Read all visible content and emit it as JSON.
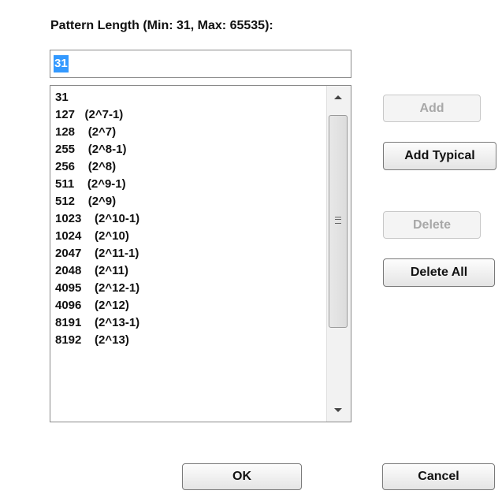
{
  "label": {
    "text": "Pattern Length (Min: 31, Max: 65535):"
  },
  "input": {
    "value": "31"
  },
  "list": {
    "items": [
      "31",
      "127   (2^7-1)",
      "128    (2^7)",
      "255    (2^8-1)",
      "256    (2^8)",
      "511    (2^9-1)",
      "512    (2^9)",
      "1023    (2^10-1)",
      "1024    (2^10)",
      "2047    (2^11-1)",
      "2048    (2^11)",
      "4095    (2^12-1)",
      "4096    (2^12)",
      "8191    (2^13-1)",
      "8192    (2^13)"
    ]
  },
  "buttons": {
    "add": "Add",
    "add_typical": "Add Typical",
    "delete": "Delete",
    "delete_all": "Delete All",
    "ok": "OK",
    "cancel": "Cancel"
  },
  "icons": {
    "scroll_up": "chevron-up-icon",
    "scroll_down": "chevron-down-icon",
    "thumb_grip": "grip-icon"
  },
  "colors": {
    "selection": "#3399ff",
    "disabled_text": "#a8a8a8"
  }
}
